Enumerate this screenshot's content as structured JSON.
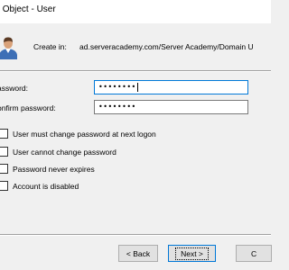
{
  "window": {
    "title": "v Object - User"
  },
  "header": {
    "create_in_label": "Create in:",
    "create_in_path": "ad.serveracademy.com/Server Academy/Domain U"
  },
  "form": {
    "password_label": "assword:",
    "password_value": "••••••••",
    "confirm_label": "onfirm password:",
    "confirm_value": "••••••••"
  },
  "options": [
    {
      "label": "User must change password at next logon",
      "checked": false
    },
    {
      "label": "User cannot change password",
      "checked": false
    },
    {
      "label": "Password never expires",
      "checked": false
    },
    {
      "label": "Account is disabled",
      "checked": false
    }
  ],
  "buttons": {
    "back": "< Back",
    "next": "Next >",
    "cancel": "C"
  },
  "icons": {
    "header_icon": "user-icon"
  },
  "colors": {
    "focus_border": "#0078d7",
    "dialog_bg": "#f0f0f0"
  }
}
